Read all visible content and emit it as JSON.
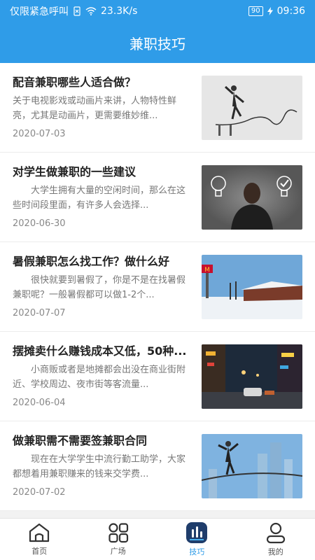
{
  "status": {
    "left_text": "仅限紧急呼叫",
    "speed": "23.3K/s",
    "battery": "90",
    "time": "09:36"
  },
  "header": {
    "title": "兼职技巧"
  },
  "articles": [
    {
      "title": "配音兼职哪些人适合做？",
      "desc": "关于电视影戏或动画片来讲，人物特性鲜亮，尤其是动画片，更需要维妙维...",
      "date": "2020-07-03",
      "image": "businessman-balancing-on-wire"
    },
    {
      "title": "对学生做兼职的一些建议",
      "desc": "大学生拥有大量的空闲时间，那么在这些时间段里面，有许多人会选择...",
      "date": "2020-06-30",
      "image": "man-between-lightbulbs"
    },
    {
      "title": "暑假兼职怎么找工作？做什么好",
      "desc": "很快就要到暑假了，你是不是在找暑假兼职呢？一般暑假都可以做1-2个...",
      "date": "2020-07-07",
      "image": "snowy-street-restaurant"
    },
    {
      "title": "摆摊卖什么赚钱成本又低，50种...",
      "desc": "小商贩或者是地摊都会出没在商业街附近、学校周边、夜市街等客流量...",
      "date": "2020-06-04",
      "image": "night-city-street"
    },
    {
      "title": "做兼职需不需要签兼职合同",
      "desc": "现在在大学学生中流行勤工助学，大家都想着用兼职赚来的钱来交学费...",
      "date": "2020-07-02",
      "image": "businessman-tightrope-city"
    }
  ],
  "tabs": [
    {
      "label": "首页",
      "icon": "home-icon"
    },
    {
      "label": "广场",
      "icon": "grid-icon"
    },
    {
      "label": "技巧",
      "icon": "chart-icon",
      "active": true
    },
    {
      "label": "我的",
      "icon": "user-icon"
    }
  ],
  "colors": {
    "primary": "#2f9ce8"
  }
}
